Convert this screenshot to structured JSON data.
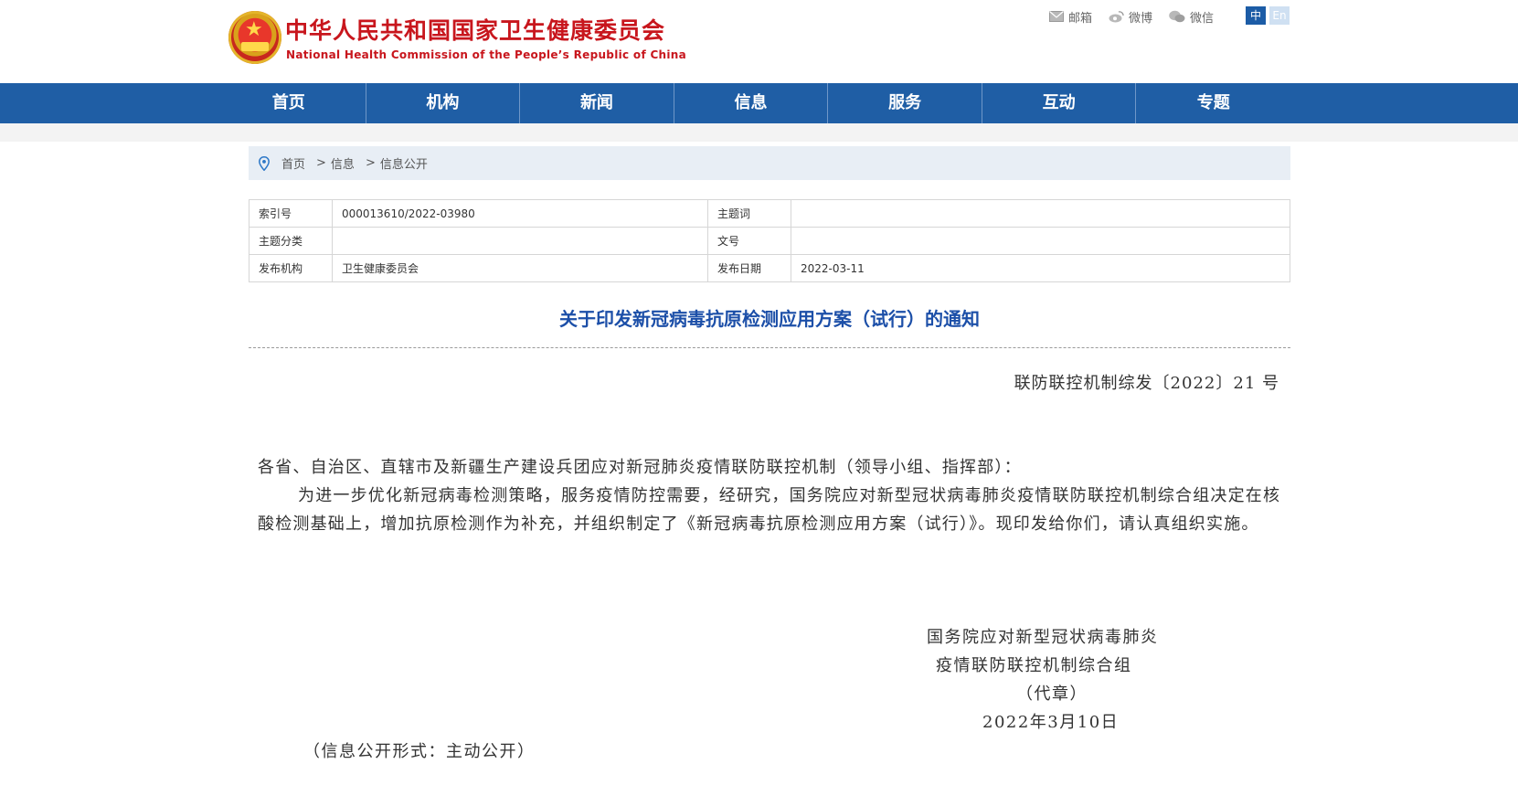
{
  "header": {
    "site_name_cn": "中华人民共和国国家卫生健康委员会",
    "site_name_en": "National Health Commission of the People’s Republic of China",
    "links": [
      {
        "icon": "mail-icon",
        "label": "邮箱"
      },
      {
        "icon": "weibo-icon",
        "label": "微博"
      },
      {
        "icon": "wechat-icon",
        "label": "微信"
      }
    ],
    "lang_zh": "中",
    "lang_en": "En"
  },
  "nav": {
    "items": [
      "首页",
      "机构",
      "新闻",
      "信息",
      "服务",
      "互动",
      "专题"
    ]
  },
  "breadcrumb": {
    "icon": "location-pin-icon",
    "items": [
      "首页",
      "信息",
      "信息公开"
    ],
    "separator": ">"
  },
  "meta": {
    "index_label": "索引号",
    "index_value": "000013610/2022-03980",
    "keyword_label": "主题词",
    "keyword_value": "",
    "category_label": "主题分类",
    "category_value": "",
    "docno_label": "文号",
    "docno_value": "",
    "issuer_label": "发布机构",
    "issuer_value": "卫生健康委员会",
    "date_label": "发布日期",
    "date_value": "2022-03-11"
  },
  "document": {
    "title": "关于印发新冠病毒抗原检测应用方案（试行）的通知",
    "number": "联防联控机制综发〔2022〕21 号",
    "addressee": "各省、自治区、直辖市及新疆生产建设兵团应对新冠肺炎疫情联防联控机制（领导小组、指挥部）：",
    "paragraph": "为进一步优化新冠病毒检测策略，服务疫情防控需要，经研究，国务院应对新型冠状病毒肺炎疫情联防联控机制综合组决定在核酸检测基础上，增加抗原检测作为补充，并组织制定了《新冠病毒抗原检测应用方案（试行）》。现印发给你们，请认真组织实施。",
    "signature_line1": "国务院应对新型冠状病毒肺炎",
    "signature_line2": "疫情联防联控机制综合组",
    "signature_line3": "（代章）",
    "signature_date": "2022年3月10日",
    "disclosure": "（信息公开形式：主动公开）"
  },
  "colors": {
    "brand_red": "#c8161d",
    "nav_blue": "#1f5ea5",
    "title_blue": "#1c4fa8",
    "breadcrumb_bg": "#e8eef5"
  }
}
